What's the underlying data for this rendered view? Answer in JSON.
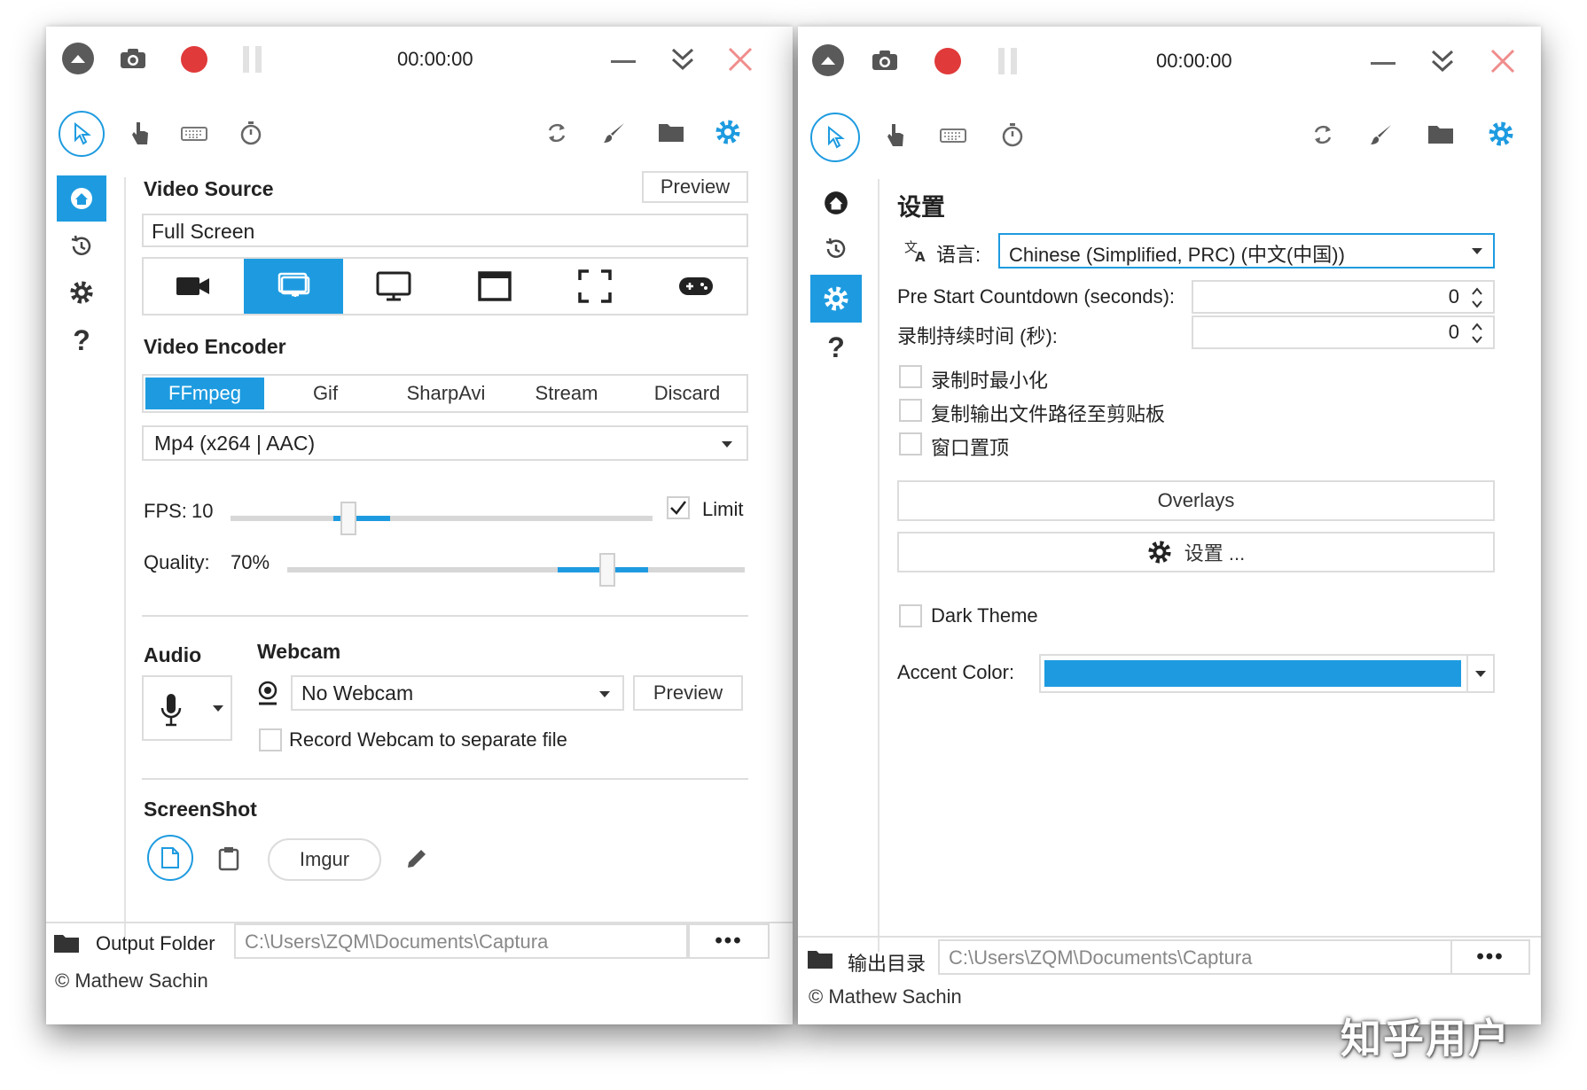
{
  "left": {
    "timer": "00:00:00",
    "video_source": {
      "title": "Video Source",
      "preview_label": "Preview",
      "source_value": "Full Screen",
      "icons": [
        "video-camera-icon",
        "desktop-selected-icon",
        "monitor-icon",
        "window-icon",
        "region-icon",
        "gamepad-icon"
      ]
    },
    "video_encoder": {
      "title": "Video Encoder",
      "tabs": [
        "FFmpeg",
        "Gif",
        "SharpAvi",
        "Stream",
        "Discard"
      ],
      "selected_tab": "FFmpeg",
      "format": "Mp4 (x264 | AAC)",
      "fps_label": "FPS:",
      "fps_value": "10",
      "fps_level": 0.26,
      "limit_label": "Limit",
      "limit_checked": true,
      "quality_label": "Quality:",
      "quality_value": "70%",
      "quality_level": 0.7
    },
    "audio": {
      "title": "Audio"
    },
    "webcam": {
      "title": "Webcam",
      "value": "No Webcam",
      "preview_label": "Preview",
      "separate_file_label": "Record Webcam to separate file"
    },
    "screenshot": {
      "title": "ScreenShot",
      "imgur_label": "Imgur"
    },
    "output": {
      "label": "Output Folder",
      "path": "C:\\Users\\ZQM\\Documents\\Captura",
      "more": "•••"
    },
    "copyright": "© Mathew Sachin"
  },
  "right": {
    "timer": "00:00:00",
    "settings_title": "设置",
    "language_label": "语言:",
    "language_value": "Chinese (Simplified, PRC) (中文(中国))",
    "countdown_label": "Pre Start Countdown (seconds):",
    "countdown_value": "0",
    "duration_label": "录制持续时间 (秒):",
    "duration_value": "0",
    "checkboxes": [
      "录制时最小化",
      "复制输出文件路径至剪贴板",
      "窗口置顶"
    ],
    "overlays_label": "Overlays",
    "settings_button_label": "设置 ...",
    "dark_theme_label": "Dark Theme",
    "accent_label": "Accent Color:",
    "accent_color": "#1e9be0",
    "output": {
      "label": "输出目录",
      "path": "C:\\Users\\ZQM\\Documents\\Captura",
      "more": "•••"
    },
    "copyright": "© Mathew Sachin"
  },
  "watermark": "知乎用户",
  "colors": {
    "accent": "#1e9be0",
    "record": "#e03a3a",
    "close": "#f08c8c"
  }
}
